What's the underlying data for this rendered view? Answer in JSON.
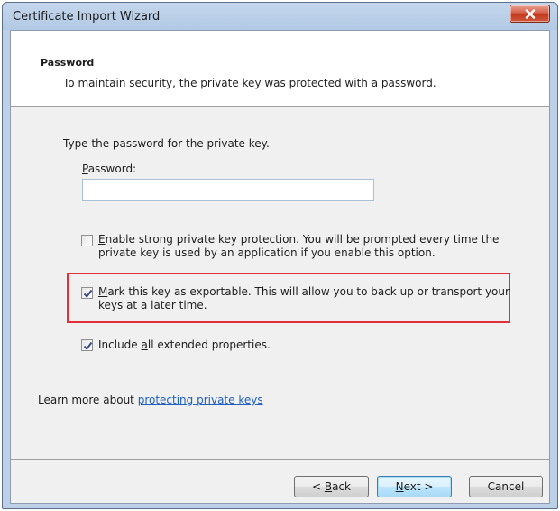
{
  "window": {
    "title": "Certificate Import Wizard"
  },
  "header": {
    "title": "Password",
    "subtitle": "To maintain security, the private key was protected with a password."
  },
  "body": {
    "prompt": "Type the password for the private key.",
    "password_label_mnemonic": "P",
    "password_label_rest": "assword:",
    "password_value": ""
  },
  "options": [
    {
      "checked": false,
      "line1_mnemonic": "E",
      "line1_rest": "nable strong private key protection. You will be prompted every time the",
      "line2": "private key is used by an application if you enable this option."
    },
    {
      "checked": true,
      "line1_mnemonic": "M",
      "line1_rest": "ark this key as exportable. This will allow you to back up or transport your",
      "line2": "keys at a later time."
    },
    {
      "checked": true,
      "line1_pre": "Include ",
      "line1_mnemonic": "a",
      "line1_rest": "ll extended properties."
    }
  ],
  "learn_more": {
    "prefix": "Learn more about ",
    "link": "protecting private keys"
  },
  "buttons": {
    "back_pre": "< ",
    "back_mnemonic": "B",
    "back_rest": "ack",
    "next_mnemonic": "N",
    "next_rest": "ext >",
    "cancel": "Cancel"
  },
  "colors": {
    "highlight_border": "#e2303a",
    "link": "#1f5fbf",
    "close_button": "#c2391f"
  },
  "icons": {
    "close": "close-icon",
    "checkmark": "checkmark-icon"
  }
}
